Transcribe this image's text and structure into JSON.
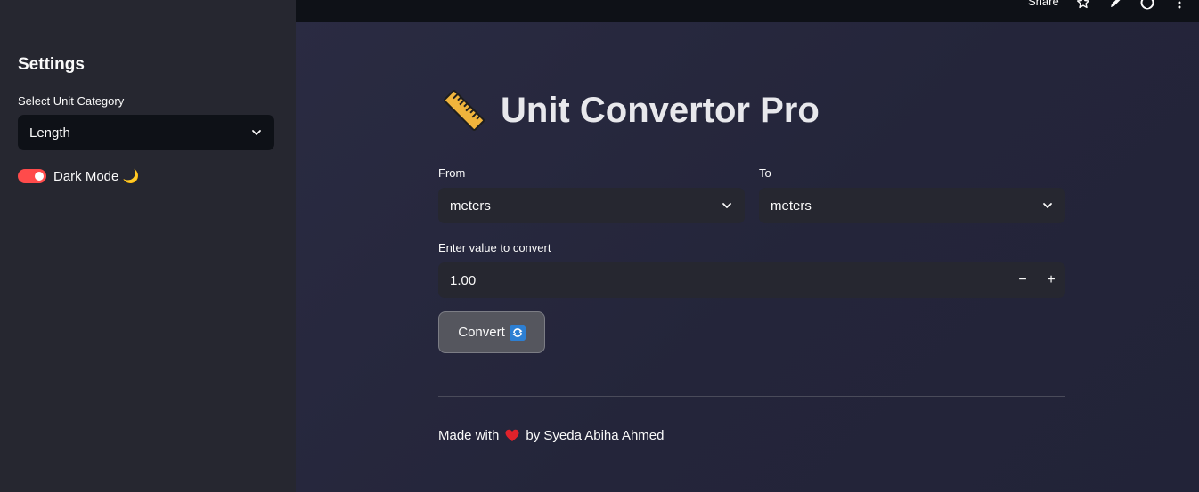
{
  "topbar": {
    "share_label": "Share",
    "icons": [
      "star-icon",
      "pencil-icon",
      "github-icon",
      "more-icon"
    ]
  },
  "sidebar": {
    "title": "Settings",
    "category_label": "Select Unit Category",
    "category_value": "Length",
    "dark_mode_label": "Dark Mode 🌙",
    "dark_mode_on": true
  },
  "main": {
    "title": "Unit Convertor Pro",
    "title_icon": "ruler-icon",
    "from_label": "From",
    "from_value": "meters",
    "to_label": "To",
    "to_value": "meters",
    "value_label": "Enter value to convert",
    "value": "1.00",
    "minus_label": "−",
    "plus_label": "+",
    "convert_label": "Convert",
    "footer_prefix": "Made with",
    "footer_suffix": "by Syeda Abiha Ahmed"
  },
  "colors": {
    "accent": "#ff4b4b",
    "sidebar_bg": "#262730",
    "main_bg": "#26273a",
    "input_bg": "#262730"
  }
}
